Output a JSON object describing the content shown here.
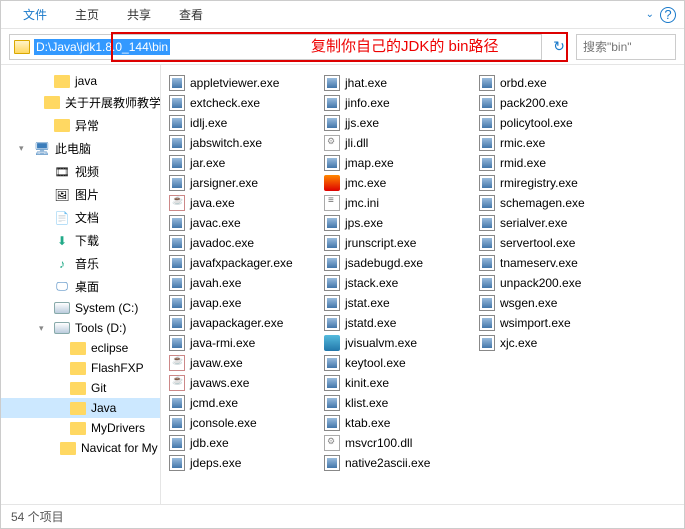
{
  "menubar": {
    "file": "文件",
    "home": "主页",
    "share": "共享",
    "view": "查看"
  },
  "address": {
    "path": "D:\\Java\\jdk1.8.0_144\\bin",
    "annotation": "复制你自己的JDK的 bin路径",
    "search_placeholder": "搜索\"bin\""
  },
  "sidebar": {
    "items": [
      {
        "label": "java",
        "icon": "folder",
        "depth": 2
      },
      {
        "label": "关于开展教师教学",
        "icon": "folder",
        "depth": 2
      },
      {
        "label": "异常",
        "icon": "folder",
        "depth": 2
      },
      {
        "label": "此电脑",
        "icon": "pc",
        "depth": 1,
        "caret": "▾"
      },
      {
        "label": "视频",
        "icon": "video",
        "depth": 2
      },
      {
        "label": "图片",
        "icon": "pic",
        "depth": 2
      },
      {
        "label": "文档",
        "icon": "doc",
        "depth": 2
      },
      {
        "label": "下载",
        "icon": "dl",
        "depth": 2
      },
      {
        "label": "音乐",
        "icon": "music",
        "depth": 2
      },
      {
        "label": "桌面",
        "icon": "desk",
        "depth": 2
      },
      {
        "label": "System (C:)",
        "icon": "drive",
        "depth": 2
      },
      {
        "label": "Tools (D:)",
        "icon": "drive",
        "depth": 2,
        "caret": "▾"
      },
      {
        "label": "eclipse",
        "icon": "folder",
        "depth": 3
      },
      {
        "label": "FlashFXP",
        "icon": "folder",
        "depth": 3
      },
      {
        "label": "Git",
        "icon": "folder",
        "depth": 3
      },
      {
        "label": "Java",
        "icon": "folder",
        "depth": 3,
        "active": true
      },
      {
        "label": "MyDrivers",
        "icon": "folder",
        "depth": 3
      },
      {
        "label": "Navicat for My",
        "icon": "folder",
        "depth": 3
      }
    ]
  },
  "files": {
    "col1": [
      {
        "name": "appletviewer.exe",
        "icon": "exe"
      },
      {
        "name": "extcheck.exe",
        "icon": "exe"
      },
      {
        "name": "idlj.exe",
        "icon": "exe"
      },
      {
        "name": "jabswitch.exe",
        "icon": "exe"
      },
      {
        "name": "jar.exe",
        "icon": "exe"
      },
      {
        "name": "jarsigner.exe",
        "icon": "exe"
      },
      {
        "name": "java.exe",
        "icon": "java"
      },
      {
        "name": "javac.exe",
        "icon": "exe"
      },
      {
        "name": "javadoc.exe",
        "icon": "exe"
      },
      {
        "name": "javafxpackager.exe",
        "icon": "exe"
      },
      {
        "name": "javah.exe",
        "icon": "exe"
      },
      {
        "name": "javap.exe",
        "icon": "exe"
      },
      {
        "name": "javapackager.exe",
        "icon": "exe"
      },
      {
        "name": "java-rmi.exe",
        "icon": "exe"
      },
      {
        "name": "javaw.exe",
        "icon": "java"
      },
      {
        "name": "javaws.exe",
        "icon": "java"
      },
      {
        "name": "jcmd.exe",
        "icon": "exe"
      },
      {
        "name": "jconsole.exe",
        "icon": "exe"
      },
      {
        "name": "jdb.exe",
        "icon": "exe"
      },
      {
        "name": "jdeps.exe",
        "icon": "exe"
      }
    ],
    "col2": [
      {
        "name": "jhat.exe",
        "icon": "exe"
      },
      {
        "name": "jinfo.exe",
        "icon": "exe"
      },
      {
        "name": "jjs.exe",
        "icon": "exe"
      },
      {
        "name": "jli.dll",
        "icon": "dll"
      },
      {
        "name": "jmap.exe",
        "icon": "exe"
      },
      {
        "name": "jmc.exe",
        "icon": "jmc"
      },
      {
        "name": "jmc.ini",
        "icon": "ini"
      },
      {
        "name": "jps.exe",
        "icon": "exe"
      },
      {
        "name": "jrunscript.exe",
        "icon": "exe"
      },
      {
        "name": "jsadebugd.exe",
        "icon": "exe"
      },
      {
        "name": "jstack.exe",
        "icon": "exe"
      },
      {
        "name": "jstat.exe",
        "icon": "exe"
      },
      {
        "name": "jstatd.exe",
        "icon": "exe"
      },
      {
        "name": "jvisualvm.exe",
        "icon": "jv"
      },
      {
        "name": "keytool.exe",
        "icon": "exe"
      },
      {
        "name": "kinit.exe",
        "icon": "exe"
      },
      {
        "name": "klist.exe",
        "icon": "exe"
      },
      {
        "name": "ktab.exe",
        "icon": "exe"
      },
      {
        "name": "msvcr100.dll",
        "icon": "dll"
      },
      {
        "name": "native2ascii.exe",
        "icon": "exe"
      }
    ],
    "col3": [
      {
        "name": "orbd.exe",
        "icon": "exe"
      },
      {
        "name": "pack200.exe",
        "icon": "exe"
      },
      {
        "name": "policytool.exe",
        "icon": "exe"
      },
      {
        "name": "rmic.exe",
        "icon": "exe"
      },
      {
        "name": "rmid.exe",
        "icon": "exe"
      },
      {
        "name": "rmiregistry.exe",
        "icon": "exe"
      },
      {
        "name": "schemagen.exe",
        "icon": "exe"
      },
      {
        "name": "serialver.exe",
        "icon": "exe"
      },
      {
        "name": "servertool.exe",
        "icon": "exe"
      },
      {
        "name": "tnameserv.exe",
        "icon": "exe"
      },
      {
        "name": "unpack200.exe",
        "icon": "exe"
      },
      {
        "name": "wsgen.exe",
        "icon": "exe"
      },
      {
        "name": "wsimport.exe",
        "icon": "exe"
      },
      {
        "name": "xjc.exe",
        "icon": "exe"
      }
    ]
  },
  "status": {
    "text": "54 个项目"
  }
}
